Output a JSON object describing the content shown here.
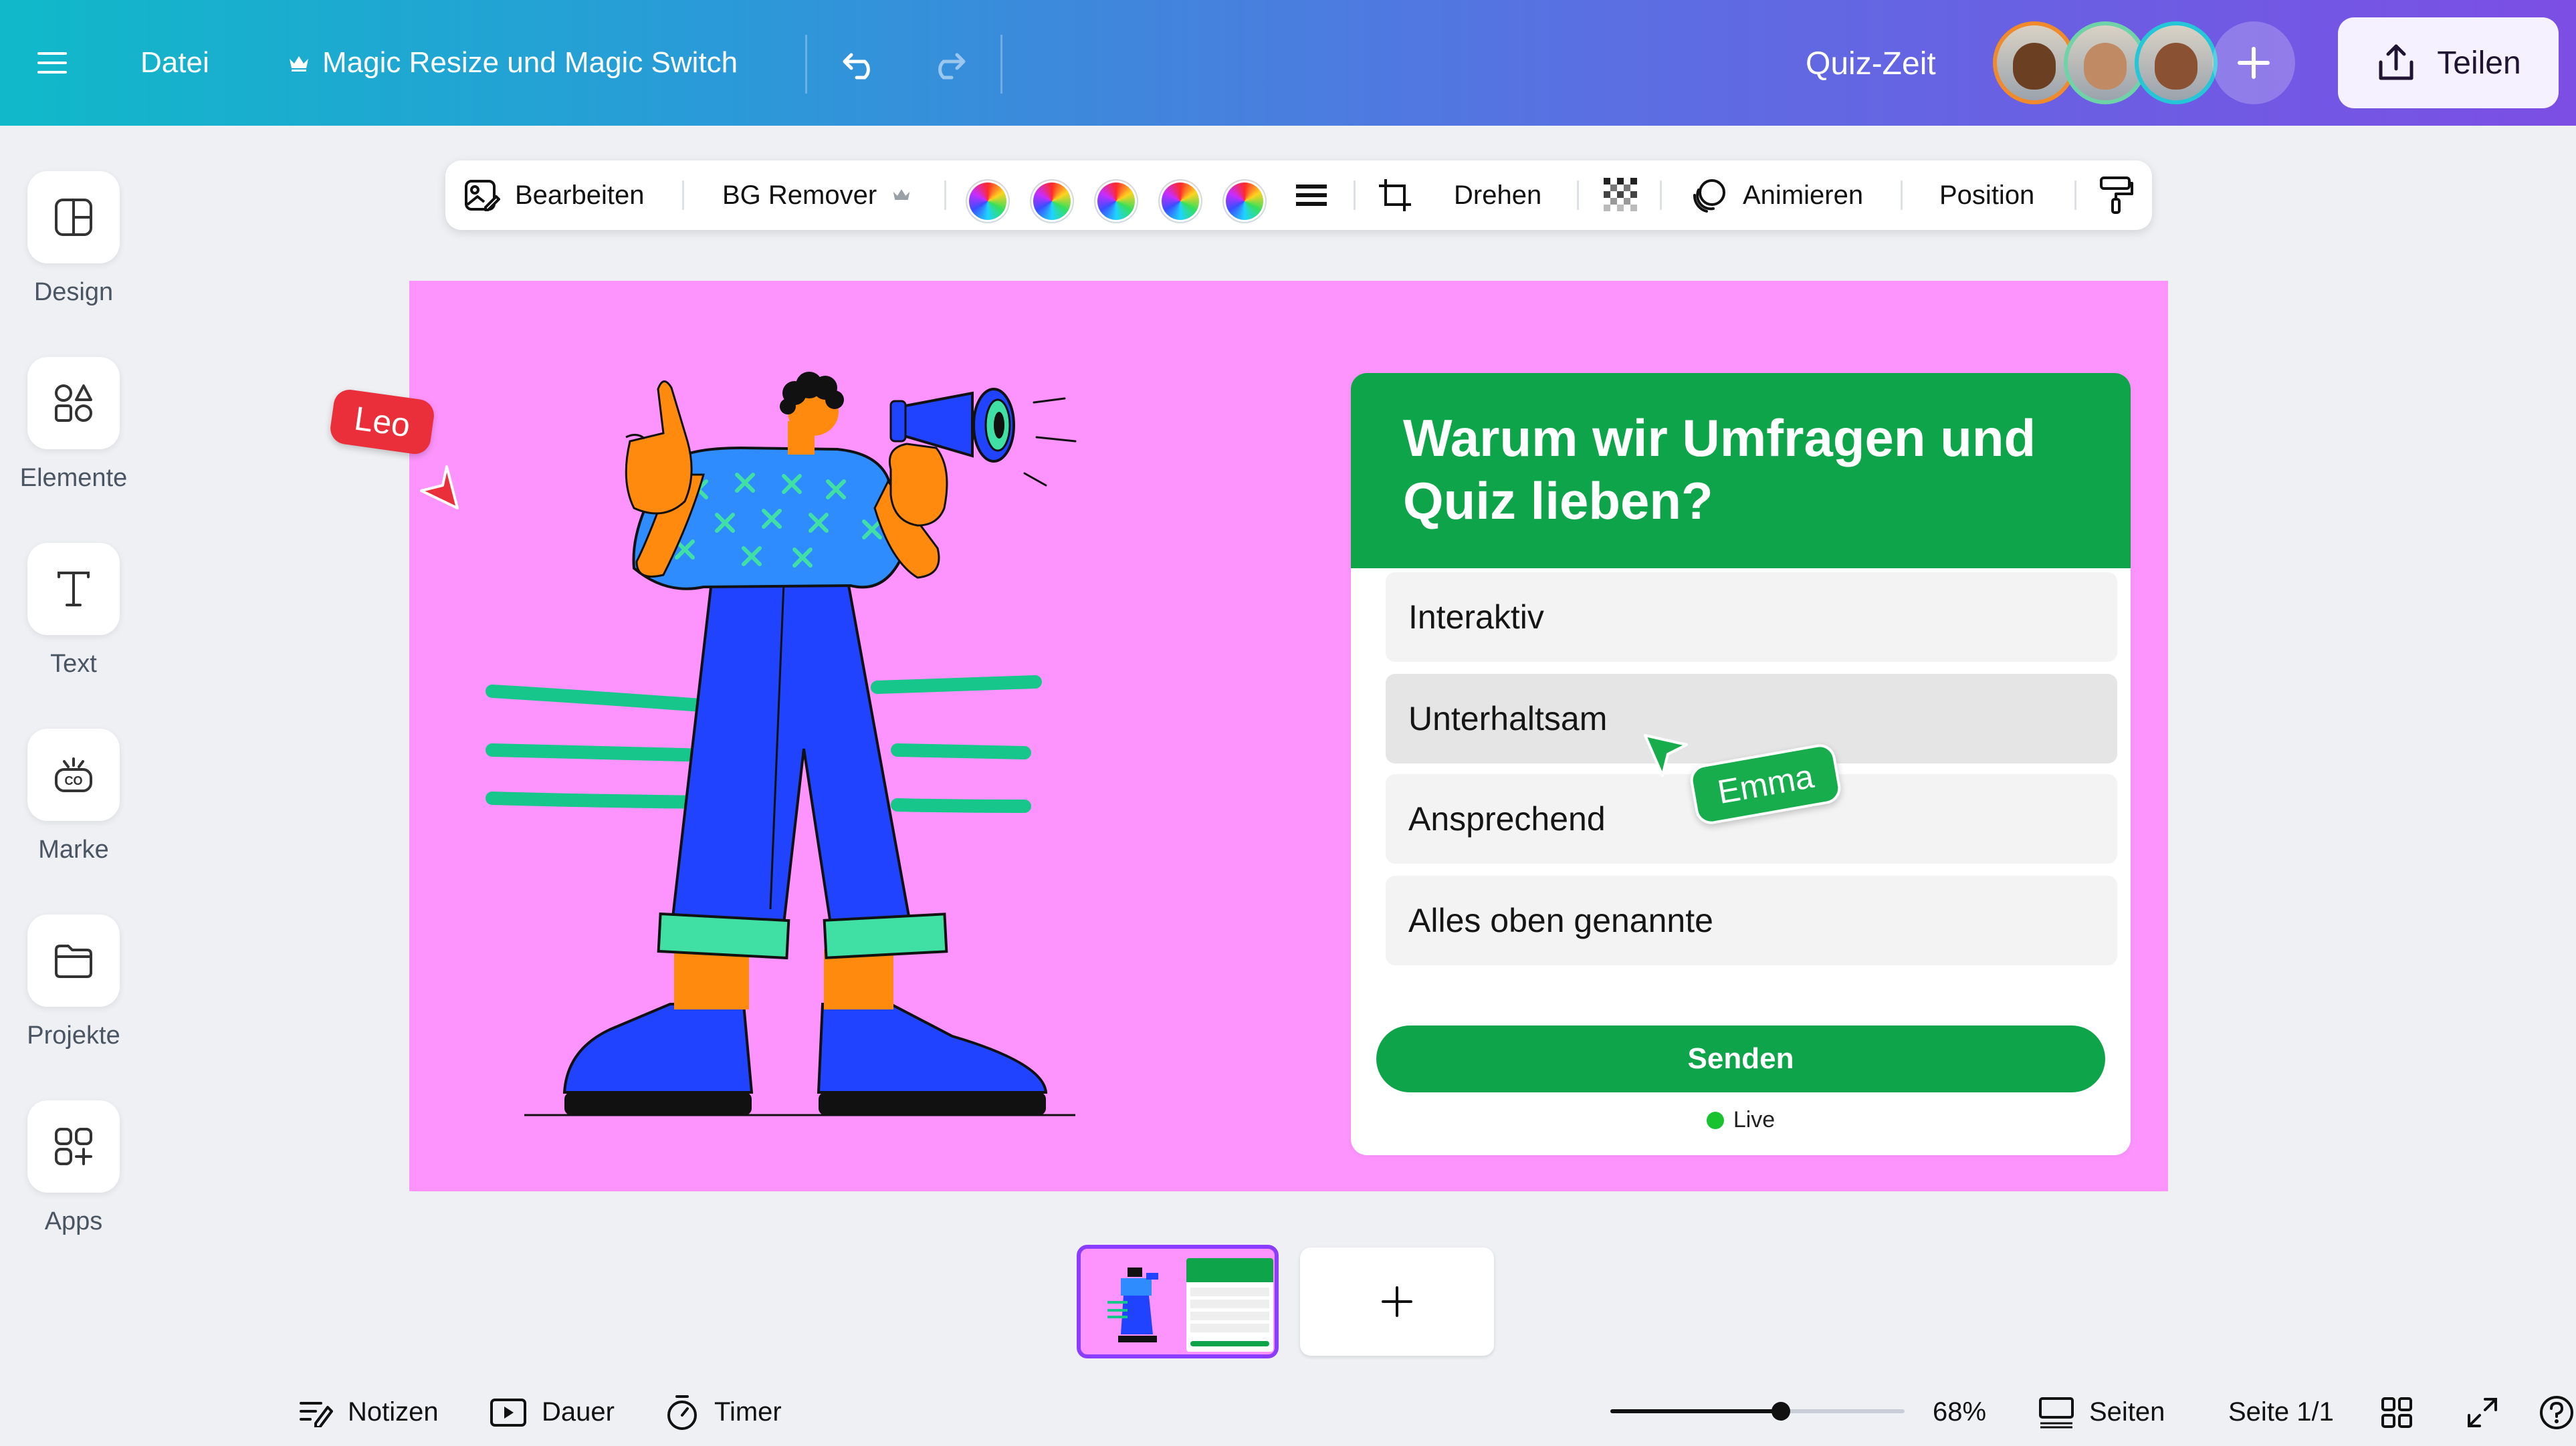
{
  "topbar": {
    "file_label": "Datei",
    "magic_label": "Magic Resize und Magic Switch",
    "design_title": "Quiz-Zeit",
    "share_label": "Teilen",
    "icons": [
      "menu-icon",
      "crown-icon",
      "undo-icon",
      "redo-icon",
      "plus-icon",
      "share-icon"
    ]
  },
  "collaborators": [
    {
      "border": "#f08a2a",
      "face": "#6b3f22"
    },
    {
      "border": "#6fd3a8",
      "face": "#c08b64"
    },
    {
      "border": "#24c6d8",
      "face": "#8a5233"
    }
  ],
  "sidebar": {
    "items": [
      {
        "label": "Design",
        "icon": "layout-icon"
      },
      {
        "label": "Elemente",
        "icon": "shapes-icon"
      },
      {
        "label": "Text",
        "icon": "text-icon"
      },
      {
        "label": "Marke",
        "icon": "brand-icon"
      },
      {
        "label": "Projekte",
        "icon": "folder-icon"
      },
      {
        "label": "Apps",
        "icon": "apps-icon"
      }
    ]
  },
  "context_toolbar": {
    "edit_label": "Bearbeiten",
    "bg_remover_label": "BG Remover",
    "rotate_label": "Drehen",
    "animate_label": "Animieren",
    "position_label": "Position",
    "swatch_count": 5
  },
  "quiz": {
    "title": "Warum wir Umfragen und Quiz lieben?",
    "options": [
      "Interaktiv",
      "Unterhaltsam",
      "Ansprechend",
      "Alles oben genannte"
    ],
    "submit_label": "Senden",
    "status_label": "Live",
    "accent_color": "#0ea44a"
  },
  "cursors": {
    "leo": {
      "name": "Leo",
      "color": "#ea2f3b"
    },
    "emma": {
      "name": "Emma",
      "color": "#17ad4d"
    }
  },
  "canvas": {
    "background": "#fd94fd"
  },
  "pages": {
    "add_label": "+"
  },
  "bottombar": {
    "notes_label": "Notizen",
    "duration_label": "Dauer",
    "timer_label": "Timer",
    "zoom_label": "68%",
    "zoom_value": 0.58,
    "pages_label": "Seiten",
    "page_indicator": "Seite 1/1"
  }
}
